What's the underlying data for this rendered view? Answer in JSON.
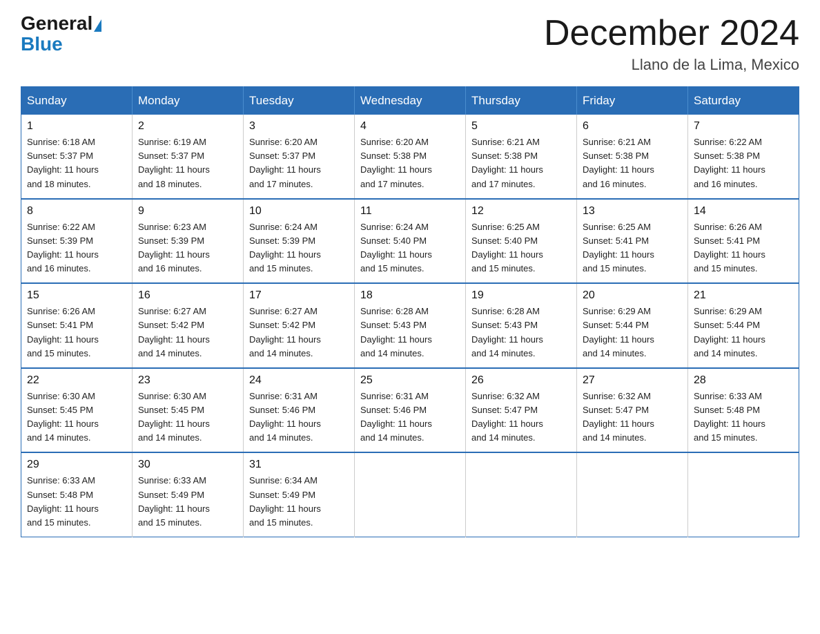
{
  "logo": {
    "general": "General",
    "blue": "Blue"
  },
  "header": {
    "month_title": "December 2024",
    "location": "Llano de la Lima, Mexico"
  },
  "days_of_week": [
    "Sunday",
    "Monday",
    "Tuesday",
    "Wednesday",
    "Thursday",
    "Friday",
    "Saturday"
  ],
  "weeks": [
    [
      {
        "day": "1",
        "sunrise": "6:18 AM",
        "sunset": "5:37 PM",
        "daylight": "11 hours and 18 minutes."
      },
      {
        "day": "2",
        "sunrise": "6:19 AM",
        "sunset": "5:37 PM",
        "daylight": "11 hours and 18 minutes."
      },
      {
        "day": "3",
        "sunrise": "6:20 AM",
        "sunset": "5:37 PM",
        "daylight": "11 hours and 17 minutes."
      },
      {
        "day": "4",
        "sunrise": "6:20 AM",
        "sunset": "5:38 PM",
        "daylight": "11 hours and 17 minutes."
      },
      {
        "day": "5",
        "sunrise": "6:21 AM",
        "sunset": "5:38 PM",
        "daylight": "11 hours and 17 minutes."
      },
      {
        "day": "6",
        "sunrise": "6:21 AM",
        "sunset": "5:38 PM",
        "daylight": "11 hours and 16 minutes."
      },
      {
        "day": "7",
        "sunrise": "6:22 AM",
        "sunset": "5:38 PM",
        "daylight": "11 hours and 16 minutes."
      }
    ],
    [
      {
        "day": "8",
        "sunrise": "6:22 AM",
        "sunset": "5:39 PM",
        "daylight": "11 hours and 16 minutes."
      },
      {
        "day": "9",
        "sunrise": "6:23 AM",
        "sunset": "5:39 PM",
        "daylight": "11 hours and 16 minutes."
      },
      {
        "day": "10",
        "sunrise": "6:24 AM",
        "sunset": "5:39 PM",
        "daylight": "11 hours and 15 minutes."
      },
      {
        "day": "11",
        "sunrise": "6:24 AM",
        "sunset": "5:40 PM",
        "daylight": "11 hours and 15 minutes."
      },
      {
        "day": "12",
        "sunrise": "6:25 AM",
        "sunset": "5:40 PM",
        "daylight": "11 hours and 15 minutes."
      },
      {
        "day": "13",
        "sunrise": "6:25 AM",
        "sunset": "5:41 PM",
        "daylight": "11 hours and 15 minutes."
      },
      {
        "day": "14",
        "sunrise": "6:26 AM",
        "sunset": "5:41 PM",
        "daylight": "11 hours and 15 minutes."
      }
    ],
    [
      {
        "day": "15",
        "sunrise": "6:26 AM",
        "sunset": "5:41 PM",
        "daylight": "11 hours and 15 minutes."
      },
      {
        "day": "16",
        "sunrise": "6:27 AM",
        "sunset": "5:42 PM",
        "daylight": "11 hours and 14 minutes."
      },
      {
        "day": "17",
        "sunrise": "6:27 AM",
        "sunset": "5:42 PM",
        "daylight": "11 hours and 14 minutes."
      },
      {
        "day": "18",
        "sunrise": "6:28 AM",
        "sunset": "5:43 PM",
        "daylight": "11 hours and 14 minutes."
      },
      {
        "day": "19",
        "sunrise": "6:28 AM",
        "sunset": "5:43 PM",
        "daylight": "11 hours and 14 minutes."
      },
      {
        "day": "20",
        "sunrise": "6:29 AM",
        "sunset": "5:44 PM",
        "daylight": "11 hours and 14 minutes."
      },
      {
        "day": "21",
        "sunrise": "6:29 AM",
        "sunset": "5:44 PM",
        "daylight": "11 hours and 14 minutes."
      }
    ],
    [
      {
        "day": "22",
        "sunrise": "6:30 AM",
        "sunset": "5:45 PM",
        "daylight": "11 hours and 14 minutes."
      },
      {
        "day": "23",
        "sunrise": "6:30 AM",
        "sunset": "5:45 PM",
        "daylight": "11 hours and 14 minutes."
      },
      {
        "day": "24",
        "sunrise": "6:31 AM",
        "sunset": "5:46 PM",
        "daylight": "11 hours and 14 minutes."
      },
      {
        "day": "25",
        "sunrise": "6:31 AM",
        "sunset": "5:46 PM",
        "daylight": "11 hours and 14 minutes."
      },
      {
        "day": "26",
        "sunrise": "6:32 AM",
        "sunset": "5:47 PM",
        "daylight": "11 hours and 14 minutes."
      },
      {
        "day": "27",
        "sunrise": "6:32 AM",
        "sunset": "5:47 PM",
        "daylight": "11 hours and 14 minutes."
      },
      {
        "day": "28",
        "sunrise": "6:33 AM",
        "sunset": "5:48 PM",
        "daylight": "11 hours and 15 minutes."
      }
    ],
    [
      {
        "day": "29",
        "sunrise": "6:33 AM",
        "sunset": "5:48 PM",
        "daylight": "11 hours and 15 minutes."
      },
      {
        "day": "30",
        "sunrise": "6:33 AM",
        "sunset": "5:49 PM",
        "daylight": "11 hours and 15 minutes."
      },
      {
        "day": "31",
        "sunrise": "6:34 AM",
        "sunset": "5:49 PM",
        "daylight": "11 hours and 15 minutes."
      },
      null,
      null,
      null,
      null
    ]
  ]
}
